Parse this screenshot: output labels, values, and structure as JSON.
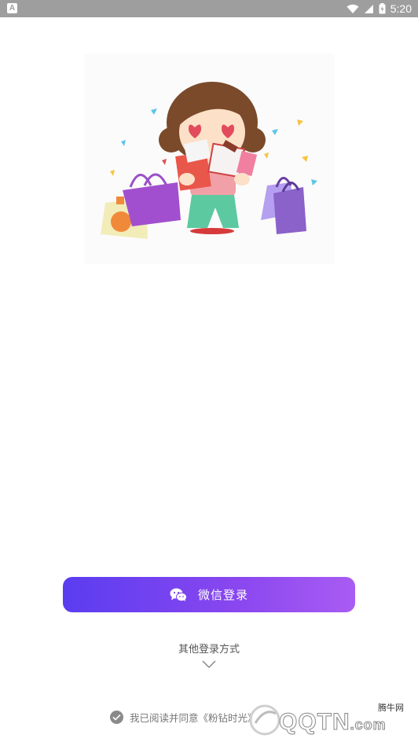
{
  "status_bar": {
    "left_icon": "A",
    "time": "5:20",
    "icons": [
      "wifi-icon",
      "signal-icon",
      "battery-icon"
    ]
  },
  "illustration": {
    "description_icon": "shopping-girl-illustration"
  },
  "login": {
    "wechat_label": "微信登录",
    "other_methods_label": "其他登录方式"
  },
  "agreement": {
    "text": "我已阅读并同意《粉钻时光》"
  },
  "watermark": {
    "brand": "腾牛网",
    "text": "QQTN",
    "suffix": ".com"
  },
  "colors": {
    "button_start": "#5a3df0",
    "button_end": "#a95cf3",
    "status_bar": "#9e9e9e"
  }
}
